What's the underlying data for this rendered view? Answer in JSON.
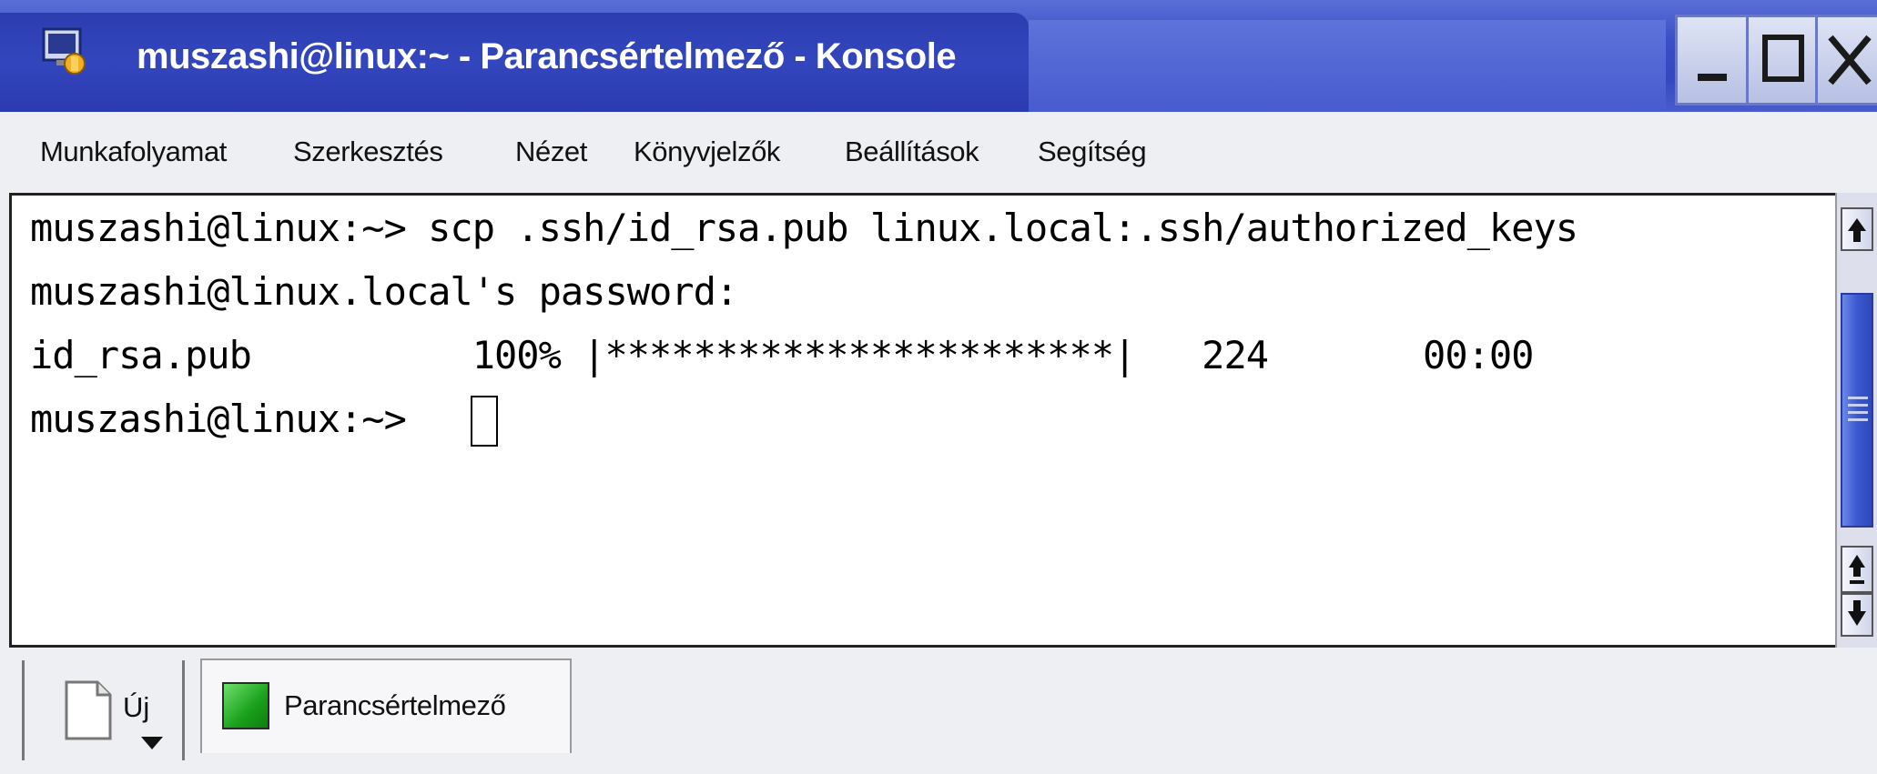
{
  "window": {
    "title": "muszashi@linux:~ - Parancsértelmező - Konsole",
    "controls": {
      "minimize_icon": "minimize-icon",
      "maximize_icon": "maximize-icon",
      "close_icon": "close-icon"
    }
  },
  "menu": {
    "items": [
      {
        "label": "Munkafolyamat"
      },
      {
        "label": "Szerkesztés"
      },
      {
        "label": "Nézet"
      },
      {
        "label": "Könyvjelzők"
      },
      {
        "label": "Beállítások"
      },
      {
        "label": "Segítség"
      }
    ]
  },
  "terminal": {
    "lines": [
      "muszashi@linux:~> scp .ssh/id_rsa.pub linux.local:.ssh/authorized_keys",
      "muszashi@linux.local's password:",
      "id_rsa.pub          100% |***********************|   224       00:00",
      "muszashi@linux:~> "
    ]
  },
  "tabs": {
    "new_label": "Új",
    "session_label": "Parancsértelmező"
  },
  "colors": {
    "titlebar": "#3447bf",
    "background": "#3a44d8",
    "scroll_thumb": "#3b58d0",
    "session_icon": "#1aa01a"
  }
}
